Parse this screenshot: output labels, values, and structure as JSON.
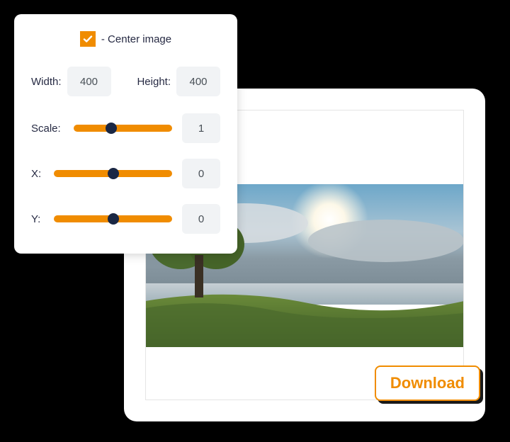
{
  "controls": {
    "center_image_label": "- Center image",
    "center_image_checked": true,
    "width_label": "Width:",
    "width_value": "400",
    "height_label": "Height:",
    "height_value": "400",
    "scale_label": "Scale:",
    "scale_value": "1",
    "scale_position_pct": 38,
    "x_label": "X:",
    "x_value": "0",
    "x_position_pct": 50,
    "y_label": "Y:",
    "y_value": "0",
    "y_position_pct": 50
  },
  "download_button_label": "Download",
  "colors": {
    "accent": "#f08c00",
    "thumb": "#1a2744",
    "text": "#262a43",
    "input_bg": "#f1f3f5"
  }
}
